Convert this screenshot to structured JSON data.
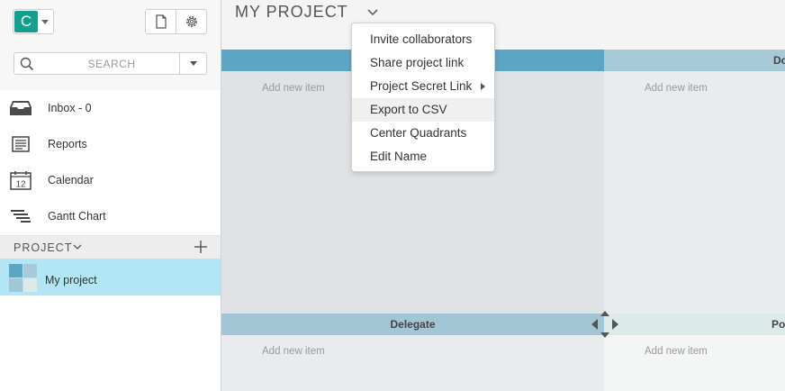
{
  "user": {
    "avatar_letter": "C",
    "avatar_color": "#11a08f"
  },
  "search": {
    "placeholder": "SEARCH"
  },
  "nav": [
    {
      "label": "Inbox - 0",
      "icon": "inbox-icon"
    },
    {
      "label": "Reports",
      "icon": "reports-icon"
    },
    {
      "label": "Calendar",
      "icon": "calendar-icon",
      "calendar_day": "12"
    },
    {
      "label": "Gantt Chart",
      "icon": "gantt-icon"
    }
  ],
  "projects": {
    "header": "PROJECT",
    "items": [
      {
        "name": "My project",
        "selected": true
      }
    ]
  },
  "main": {
    "title": "MY PROJECT",
    "quadrants": [
      {
        "label": "",
        "add_item": "Add new item",
        "color": "#5aa6c4"
      },
      {
        "label": "Do",
        "add_item": "Add new item",
        "color": "#a8c9d8"
      },
      {
        "label": "Delegate",
        "add_item": "Add new item",
        "color": "#a3c6d6"
      },
      {
        "label": "Po",
        "add_item": "Add new item",
        "color": "#dcebe9"
      }
    ]
  },
  "menu": {
    "items": [
      {
        "label": "Invite collaborators"
      },
      {
        "label": "Share project link"
      },
      {
        "label": "Project Secret Link",
        "has_submenu": true
      },
      {
        "label": "Export to CSV",
        "highlighted": true
      },
      {
        "label": "Center Quadrants"
      },
      {
        "label": "Edit Name"
      }
    ]
  }
}
